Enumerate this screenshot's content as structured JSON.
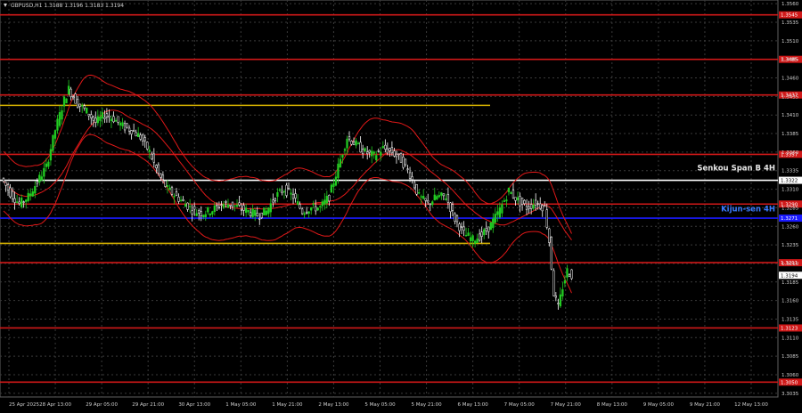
{
  "chart_data": {
    "type": "candlestick",
    "symbol_line": "GBPUSD,H1  1.3188 1.3196 1.3183 1.3194",
    "x_ticks": [
      "25 Apr 2025",
      "28 Apr 13:00",
      "29 Apr 05:00",
      "29 Apr 21:00",
      "30 Apr 13:00",
      "1 May 05:00",
      "1 May 21:00",
      "2 May 13:00",
      "5 May 05:00",
      "5 May 21:00",
      "6 May 13:00",
      "7 May 05:00",
      "7 May 21:00",
      "8 May 13:00",
      "9 May 05:00",
      "9 May 21:00",
      "12 May 13:00"
    ],
    "y_ticks": [
      3.3035,
      1.306,
      1.3085,
      1.311,
      1.3135,
      1.316,
      1.3185,
      1.321,
      1.3235,
      1.326,
      1.3285,
      1.331,
      1.3335,
      1.336,
      1.3385,
      1.341,
      1.3435,
      1.346,
      1.3485,
      1.351,
      1.3535,
      1.356
    ],
    "ylim": [
      1.303,
      1.3565
    ],
    "current_price": "1.3194",
    "hlines": [
      {
        "price": 1.3545,
        "color": "#d01818",
        "label": "1.3545"
      },
      {
        "price": 1.3485,
        "color": "#d01818",
        "label": "1.3485"
      },
      {
        "price": 1.3437,
        "color": "#d01818",
        "label": "1.3437"
      },
      {
        "price": 1.3423,
        "color": "#d4b000",
        "label": ""
      },
      {
        "price": 1.3357,
        "color": "#d01818",
        "label": "1.3357"
      },
      {
        "price": 1.3322,
        "color": "#ffffff",
        "label": "1.3322"
      },
      {
        "price": 1.329,
        "color": "#d01818",
        "label": "1.3290"
      },
      {
        "price": 1.3271,
        "color": "#1a1aff",
        "label": "1.3271"
      },
      {
        "price": 1.3237,
        "color": "#d4b000",
        "label": ""
      },
      {
        "price": 1.3211,
        "color": "#d01818",
        "label": "1.3211"
      },
      {
        "price": 1.3123,
        "color": "#d01818",
        "label": "1.3123"
      },
      {
        "price": 1.305,
        "color": "#d01818",
        "label": "1.3050"
      }
    ],
    "annotations": [
      {
        "text": "Senkou Span B 4H",
        "price": 1.3335,
        "color": "#e6e6e6"
      },
      {
        "text": "Kijun-sen 4H",
        "price": 1.328,
        "color": "#3a7bff"
      }
    ],
    "price_path": [
      [
        0,
        1.3325
      ],
      [
        2,
        1.3305
      ],
      [
        4,
        1.329
      ],
      [
        6,
        1.33
      ],
      [
        8,
        1.332
      ],
      [
        10,
        1.334
      ],
      [
        12,
        1.339
      ],
      [
        14,
        1.343
      ],
      [
        15,
        1.3445
      ],
      [
        17,
        1.3425
      ],
      [
        19,
        1.3415
      ],
      [
        21,
        1.34
      ],
      [
        23,
        1.341
      ],
      [
        25,
        1.3405
      ],
      [
        27,
        1.3395
      ],
      [
        29,
        1.339
      ],
      [
        31,
        1.338
      ],
      [
        33,
        1.336
      ],
      [
        35,
        1.333
      ],
      [
        37,
        1.331
      ],
      [
        39,
        1.33
      ],
      [
        41,
        1.329
      ],
      [
        43,
        1.328
      ],
      [
        45,
        1.3278
      ],
      [
        47,
        1.3282
      ],
      [
        49,
        1.329
      ],
      [
        51,
        1.329
      ],
      [
        53,
        1.3285
      ],
      [
        55,
        1.328
      ],
      [
        57,
        1.3275
      ],
      [
        59,
        1.328
      ],
      [
        61,
        1.33
      ],
      [
        63,
        1.331
      ],
      [
        65,
        1.33
      ],
      [
        67,
        1.328
      ],
      [
        69,
        1.3285
      ],
      [
        71,
        1.3285
      ],
      [
        73,
        1.33
      ],
      [
        75,
        1.334
      ],
      [
        77,
        1.338
      ],
      [
        79,
        1.337
      ],
      [
        81,
        1.336
      ],
      [
        83,
        1.3355
      ],
      [
        85,
        1.3365
      ],
      [
        87,
        1.336
      ],
      [
        89,
        1.335
      ],
      [
        91,
        1.333
      ],
      [
        93,
        1.33
      ],
      [
        95,
        1.329
      ],
      [
        97,
        1.33
      ],
      [
        99,
        1.33
      ],
      [
        101,
        1.327
      ],
      [
        103,
        1.325
      ],
      [
        105,
        1.3242
      ],
      [
        107,
        1.3248
      ],
      [
        109,
        1.3262
      ],
      [
        111,
        1.3282
      ],
      [
        113,
        1.3308
      ],
      [
        115,
        1.3295
      ],
      [
        117,
        1.3285
      ],
      [
        119,
        1.3292
      ],
      [
        121,
        1.3285
      ],
      [
        122,
        1.324
      ],
      [
        123,
        1.317
      ],
      [
        124,
        1.315
      ],
      [
        125,
        1.3178
      ],
      [
        126,
        1.32
      ],
      [
        127,
        1.3194
      ]
    ]
  }
}
